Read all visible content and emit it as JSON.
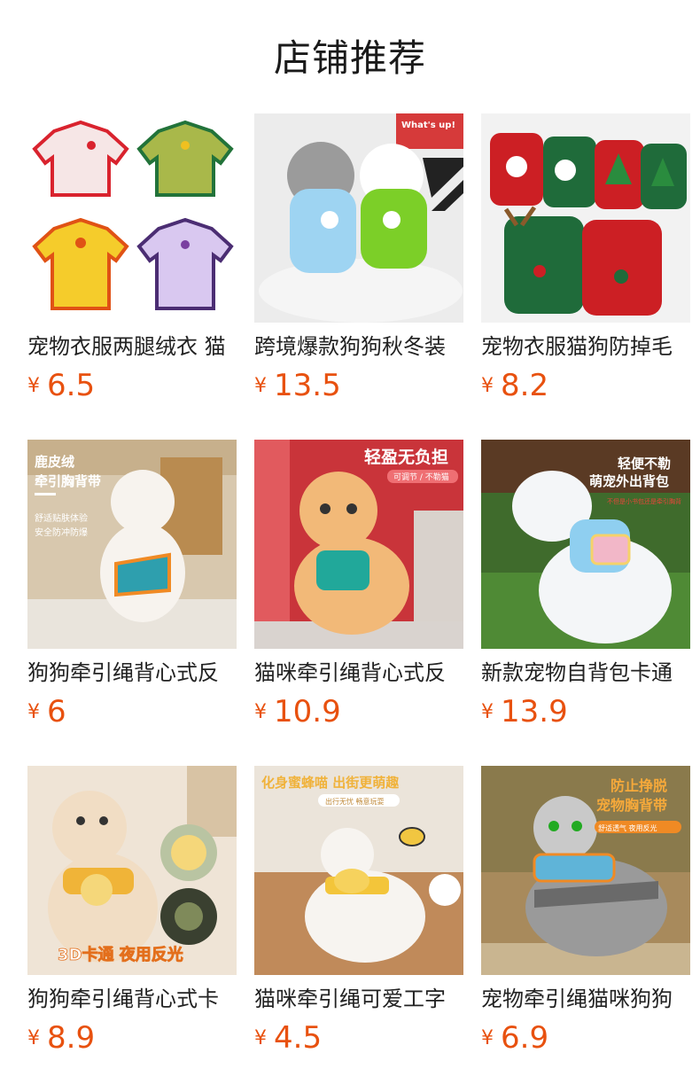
{
  "header": {
    "title": "店铺推荐"
  },
  "currency": "¥",
  "products": [
    {
      "name": "宠物衣服两腿绒衣 猫",
      "price": "6.5",
      "image": {
        "alt": "pastel fleece pet sweaters",
        "overlay": []
      }
    },
    {
      "name": "跨境爆款狗狗秋冬装",
      "price": "13.5",
      "image": {
        "alt": "two dogs in sweaters",
        "overlay": [
          "What's up!"
        ]
      }
    },
    {
      "name": "宠物衣服猫狗防掉毛",
      "price": "8.2",
      "image": {
        "alt": "christmas pet sweaters",
        "overlay": []
      }
    },
    {
      "name": "狗狗牵引绳背心式反",
      "price": "6",
      "image": {
        "alt": "poodle wearing harness",
        "overlay": [
          "鹿皮绒",
          "牵引胸背带",
          "舒适贴肤体验",
          "安全防冲防爆"
        ]
      }
    },
    {
      "name": "猫咪牵引绳背心式反",
      "price": "10.9",
      "image": {
        "alt": "orange cat in harness",
        "overlay": [
          "轻盈无负担",
          "可调节 / 不勒猫"
        ]
      }
    },
    {
      "name": "新款宠物自背包卡通",
      "price": "13.9",
      "image": {
        "alt": "white dog with backpack",
        "overlay": [
          "轻便不勒",
          "萌宠外出背包",
          "不但是小书包还是牵引胸背"
        ]
      }
    },
    {
      "name": "狗狗牵引绳背心式卡",
      "price": "8.9",
      "image": {
        "alt": "dog with cartoon harness",
        "overlay": [
          "3D卡通 夜用反光"
        ]
      }
    },
    {
      "name": "猫咪牵引绳可爱工字",
      "price": "4.5",
      "image": {
        "alt": "white cat with bee harness",
        "overlay": [
          "化身蜜蜂喵 出街更萌趣",
          "出行无忧 畅意玩耍"
        ]
      }
    },
    {
      "name": "宠物牵引绳猫咪狗狗",
      "price": "6.9",
      "image": {
        "alt": "tabby cat in harness",
        "overlay": [
          "防止挣脱",
          "宠物胸背带",
          "舒适透气 夜用反光"
        ]
      }
    }
  ]
}
